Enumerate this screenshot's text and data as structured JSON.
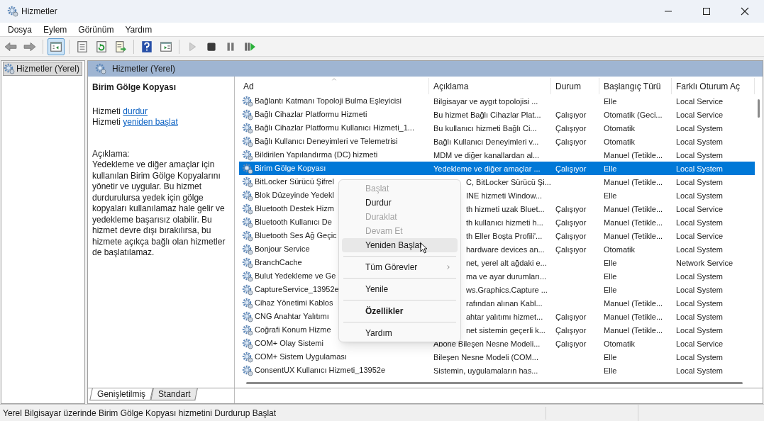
{
  "window": {
    "title": "Hizmetler"
  },
  "menu_bar": [
    "Dosya",
    "Eylem",
    "Görünüm",
    "Yardım"
  ],
  "toolbar": [
    {
      "kind": "back",
      "disabled": false,
      "selected": false
    },
    {
      "kind": "forward",
      "disabled": false,
      "selected": false
    },
    {
      "kind": "separator"
    },
    {
      "kind": "tree",
      "disabled": false,
      "selected": true
    },
    {
      "kind": "separator"
    },
    {
      "kind": "properties",
      "disabled": false,
      "selected": false
    },
    {
      "kind": "refresh",
      "disabled": false,
      "selected": false
    },
    {
      "kind": "export",
      "disabled": false,
      "selected": false
    },
    {
      "kind": "separator"
    },
    {
      "kind": "help",
      "disabled": false,
      "selected": false
    },
    {
      "kind": "pane",
      "disabled": false,
      "selected": false
    },
    {
      "kind": "separator"
    },
    {
      "kind": "play",
      "disabled": true,
      "selected": false
    },
    {
      "kind": "stop",
      "disabled": false,
      "selected": false
    },
    {
      "kind": "pause",
      "disabled": false,
      "selected": false
    },
    {
      "kind": "resume",
      "disabled": false,
      "selected": false
    }
  ],
  "tree": [
    {
      "label": "Hizmetler (Yerel)",
      "selected": true
    }
  ],
  "pane_header": "Hizmetler (Yerel)",
  "details": {
    "title": "Birim Gölge Kopyası",
    "actions": [
      {
        "prefix": "Hizmeti",
        "link": "durdur"
      },
      {
        "prefix": "Hizmeti",
        "link": "yeniden başlat"
      }
    ],
    "description_label": "Açıklama:",
    "description": "Yedekleme ve diğer amaçlar için kullanılan Birim Gölge Kopyalarını yönetir ve uygular. Bu hizmet durdurulursa yedek için gölge kopyaları kullanılamaz hale gelir ve yedekleme başarısız olabilir. Bu hizmet devre dışı bırakılırsa, bu hizmete açıkça bağlı olan hizmetler de başlatılamaz."
  },
  "table": {
    "columns": [
      "Ad",
      "Açıklama",
      "Durum",
      "Başlangıç Türü",
      "Farklı Oturum Aç"
    ],
    "rows": [
      {
        "name": "Bağlantı Katmanı Topoloji Bulma Eşleyicisi",
        "description": "Bilgisayar ve aygıt topolojisi ...",
        "status": "",
        "startup": "Elle",
        "logon": "Local Service",
        "selected": false
      },
      {
        "name": "Bağlı Cihazlar Platformu Hizmeti",
        "description": "Bu hizmet Bağlı Cihazlar Plat...",
        "status": "Çalışıyor",
        "startup": "Otomatik (Geci...",
        "logon": "Local Service",
        "selected": false
      },
      {
        "name": "Bağlı Cihazlar Platformu Kullanıcı Hizmeti_1...",
        "description": "Bu kullanıcı hizmeti Bağlı Ci...",
        "status": "Çalışıyor",
        "startup": "Otomatik",
        "logon": "Local System",
        "selected": false
      },
      {
        "name": "Bağlı Kullanıcı Deneyimleri ve Telemetrisi",
        "description": "Bağlı Kullanıcı Deneyimleri v...",
        "status": "Çalışıyor",
        "startup": "Otomatik",
        "logon": "Local System",
        "selected": false
      },
      {
        "name": "Bildirilen Yapılandırma (DC) hizmeti",
        "description": "MDM ve diğer kanallardan al...",
        "status": "",
        "startup": "Manuel (Tetikle...",
        "logon": "Local System",
        "selected": false
      },
      {
        "name": "Birim Gölge Kopyası",
        "description": "Yedekleme ve diğer amaçlar ...",
        "status": "Çalışıyor",
        "startup": "Elle",
        "logon": "Local System",
        "selected": true
      },
      {
        "name": "BitLocker Sürücü Şifrel",
        "description": "C, BitLocker Sürücü Şi...",
        "status": "",
        "startup": "Manuel (Tetikle...",
        "logon": "Local System",
        "selected": false
      },
      {
        "name": "Blok Düzeyinde Yedekl",
        "description": "INE hizmeti Window...",
        "status": "",
        "startup": "Elle",
        "logon": "Local System",
        "selected": false
      },
      {
        "name": "Bluetooth Destek Hizm",
        "description": "th hizmeti uzak Bluet...",
        "status": "Çalışıyor",
        "startup": "Manuel (Tetikle...",
        "logon": "Local Service",
        "selected": false
      },
      {
        "name": "Bluetooth Kullanıcı De",
        "description": "th kullanıcı hizmeti h...",
        "status": "Çalışıyor",
        "startup": "Manuel (Tetikle...",
        "logon": "Local System",
        "selected": false
      },
      {
        "name": "Bluetooth Ses Ağ Geçic",
        "description": "th Eller Boşta Profili'...",
        "status": "Çalışıyor",
        "startup": "Manuel (Tetikle...",
        "logon": "Local Service",
        "selected": false
      },
      {
        "name": "Bonjour Service",
        "description": "hardware devices an...",
        "status": "Çalışıyor",
        "startup": "Otomatik",
        "logon": "Local System",
        "selected": false
      },
      {
        "name": "BranchCache",
        "description": "net, yerel alt ağdaki e...",
        "status": "",
        "startup": "Elle",
        "logon": "Network Service",
        "selected": false
      },
      {
        "name": "Bulut Yedekleme ve Ge",
        "description": "ma ve ayar durumları...",
        "status": "",
        "startup": "Elle",
        "logon": "Local System",
        "selected": false
      },
      {
        "name": "CaptureService_13952e",
        "description": "ws.Graphics.Capture ...",
        "status": "",
        "startup": "Elle",
        "logon": "Local System",
        "selected": false
      },
      {
        "name": "Cihaz Yönetimi Kablos",
        "description": "rafından alınan Kabl...",
        "status": "",
        "startup": "Manuel (Tetikle...",
        "logon": "Local System",
        "selected": false
      },
      {
        "name": "CNG Anahtar Yalıtımı",
        "description": "ahtar yalıtımı hizmet...",
        "status": "Çalışıyor",
        "startup": "Manuel (Tetikle...",
        "logon": "Local System",
        "selected": false
      },
      {
        "name": "Coğrafi Konum Hizme",
        "description": "net sistemin geçerli k...",
        "status": "Çalışıyor",
        "startup": "Manuel (Tetikle...",
        "logon": "Local System",
        "selected": false
      },
      {
        "name": "COM+ Olay Sistemi",
        "description": "Abone Bileşen Nesne Modeli...",
        "status": "Çalışıyor",
        "startup": "Otomatik",
        "logon": "Local Service",
        "selected": false
      },
      {
        "name": "COM+ Sistem Uygulaması",
        "description": "Bileşen Nesne Modeli (COM...",
        "status": "",
        "startup": "Elle",
        "logon": "Local System",
        "selected": false
      },
      {
        "name": "ConsentUX Kullanıcı Hizmeti_13952e",
        "description": "Sistemin, uygulamaların has...",
        "status": "",
        "startup": "Elle",
        "logon": "Local System",
        "selected": false
      }
    ]
  },
  "context_menu": [
    {
      "kind": "item",
      "label": "Başlat",
      "disabled": true,
      "selected": false,
      "bold": false
    },
    {
      "kind": "item",
      "label": "Durdur",
      "disabled": false,
      "selected": false,
      "bold": false
    },
    {
      "kind": "item",
      "label": "Duraklat",
      "disabled": true,
      "selected": false,
      "bold": false
    },
    {
      "kind": "item",
      "label": "Devam Et",
      "disabled": true,
      "selected": false,
      "bold": false
    },
    {
      "kind": "item",
      "label": "Yeniden Başlat",
      "disabled": false,
      "selected": true,
      "bold": false
    },
    {
      "kind": "separator"
    },
    {
      "kind": "submenu",
      "label": "Tüm Görevler",
      "disabled": false,
      "selected": false,
      "bold": false
    },
    {
      "kind": "separator"
    },
    {
      "kind": "item",
      "label": "Yenile",
      "disabled": false,
      "selected": false,
      "bold": false
    },
    {
      "kind": "separator"
    },
    {
      "kind": "item",
      "label": "Özellikler",
      "disabled": false,
      "selected": false,
      "bold": true
    },
    {
      "kind": "separator"
    },
    {
      "kind": "item",
      "label": "Yardım",
      "disabled": false,
      "selected": false,
      "bold": false
    }
  ],
  "bottom_tabs": [
    {
      "label": "Genişletilmiş",
      "selected": true
    },
    {
      "label": "Standart",
      "selected": false
    }
  ],
  "status_bar": "Yerel Bilgisayar üzerinde Birim Gölge Kopyası hizmetini Durdurup Başlat"
}
